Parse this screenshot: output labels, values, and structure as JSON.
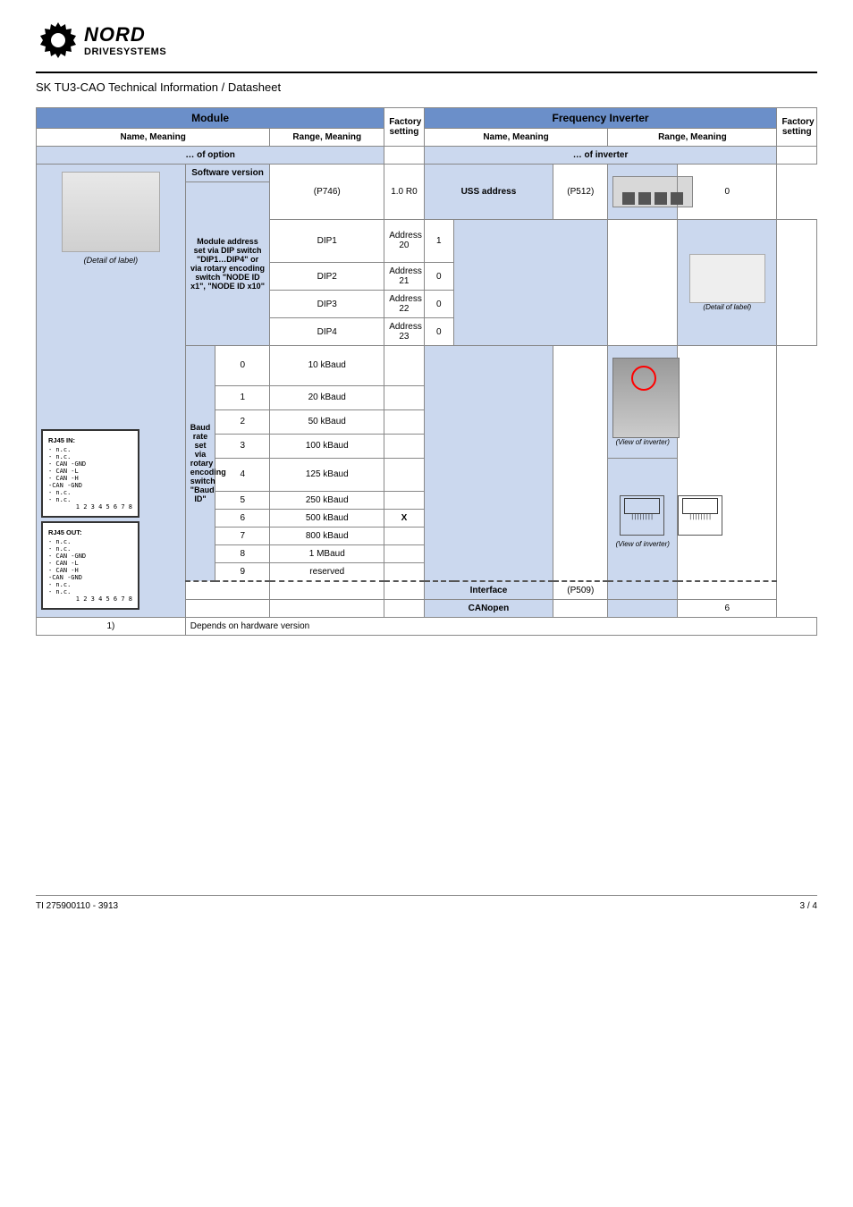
{
  "logo": {
    "brand": "NORD",
    "sub": "DRIVESYSTEMS"
  },
  "title": "SK TU3-CAO Technical Information / Datasheet",
  "headers": {
    "module": "Module",
    "inverter": "Frequency Inverter",
    "name_meaning": "Name, Meaning",
    "range_meaning": "Range, Meaning",
    "option": "… of option",
    "name_meaning2": "Name, Meaning",
    "range_meaning2": "Range, Meaning",
    "inv": "… of inverter",
    "factory": "Factory setting"
  },
  "left": {
    "labelcard": "(Detail of label)",
    "rj45in_title": "RJ45 IN:",
    "rj45out_title": "RJ45 OUT:",
    "rj45_lines": [
      "- n.c.",
      "- n.c.",
      "- CAN -GND",
      "- CAN -L",
      "- CAN -H",
      "-CAN -GND",
      "- n.c.",
      "- n.c."
    ],
    "rj45_nums_in": "1 2 3 4 5 6 7 8",
    "rj45_nums_out": "1 2 3 4 5 6 7 8"
  },
  "rows": [
    {
      "lbl": "Software version",
      "val": "(P746)",
      "rng": "",
      "lbl2": "",
      "val2": "",
      "rng2": "",
      "img": "dip",
      "imgnote": "",
      "hint": "1.0 R0"
    },
    {
      "lbl": "Module address set via DIP switch \"DIP1…DIP4\" or via rotary encoding switch \"NODE ID x1\", \"NODE ID x10\"",
      "val": "",
      "rng": "",
      "lbl2": "USS address",
      "val2": "(P512)",
      "rng2": "0",
      "img": "",
      "imgnote": "",
      "hint": ""
    },
    {
      "lbl": "",
      "val": "DIP1",
      "rng": "Address 20",
      "lbl2": "",
      "val2": "",
      "rng2": "",
      "img": "rot",
      "imgnote": "(Detail of label)",
      "hint": "1"
    },
    {
      "lbl": "",
      "val": "DIP2",
      "rng": "Address 21",
      "lbl2": "",
      "val2": "",
      "rng2": "",
      "img": "",
      "imgnote": "",
      "hint": "0"
    },
    {
      "lbl": "",
      "val": "DIP3",
      "rng": "Address 22",
      "lbl2": "",
      "val2": "",
      "rng2": "",
      "img": "",
      "imgnote": "",
      "hint": "0"
    },
    {
      "lbl": "",
      "val": "DIP4",
      "rng": "Address 23",
      "lbl2": "",
      "val2": "",
      "rng2": "",
      "img": "",
      "imgnote": "",
      "hint": "0"
    },
    {
      "lbl": "Baud rate set via rotary encoding switch \"Baud ID\"",
      "val": "0",
      "rng": "10 kBaud",
      "lbl2": "",
      "val2": "",
      "rng2": "",
      "img": "",
      "imgnote": "",
      "hint": ""
    },
    {
      "lbl": "",
      "val": "1",
      "rng": "20 kBaud",
      "lbl2": "",
      "val2": "",
      "rng2": "",
      "img": "",
      "imgnote": "",
      "hint": ""
    },
    {
      "lbl": "",
      "val": "2",
      "rng": "50 kBaud",
      "lbl2": "",
      "val2": "",
      "rng2": "",
      "img": "",
      "imgnote": "",
      "hint": ""
    },
    {
      "lbl": "",
      "val": "3",
      "rng": "100 kBaud",
      "lbl2": "",
      "val2": "",
      "rng2": "",
      "img": "inv",
      "imgnote": "(View of inverter)",
      "hint": ""
    },
    {
      "lbl": "",
      "val": "4",
      "rng": "125 kBaud",
      "lbl2": "",
      "val2": "",
      "rng2": "",
      "img": "",
      "imgnote": "",
      "hint": ""
    },
    {
      "lbl": "",
      "val": "5",
      "rng": "250 kBaud",
      "lbl2": "",
      "val2": "",
      "rng2": "",
      "img": "",
      "imgnote": "",
      "hint": ""
    },
    {
      "lbl": "",
      "val": "6",
      "rng": "500 kBaud",
      "lbl2": "",
      "val2": "",
      "rng2": "",
      "img": "",
      "imgnote": "",
      "hint": "X"
    },
    {
      "lbl": "",
      "val": "7",
      "rng": "800 kBaud",
      "lbl2": "",
      "val2": "",
      "rng2": "",
      "img": "",
      "imgnote": "",
      "hint": ""
    },
    {
      "lbl": "",
      "val": "8",
      "rng": "1 MBaud",
      "lbl2": "",
      "val2": "",
      "rng2": "",
      "img": "",
      "imgnote": "",
      "hint": ""
    },
    {
      "lbl": "",
      "val": "9",
      "rng": "reserved",
      "lbl2": "",
      "val2": "",
      "rng2": "",
      "img": "rj45",
      "imgnote": "",
      "hint": ""
    },
    {
      "lbl": "",
      "val": "",
      "rng": "",
      "lbl2": "Interface",
      "val2": "(P509)",
      "rng2": "",
      "img": "",
      "imgnote": "(View of inverter)",
      "hint": ""
    },
    {
      "lbl": "",
      "val": "",
      "rng": "",
      "lbl2": "CANopen",
      "val2": "",
      "rng2": "6",
      "img": "",
      "imgnote": "",
      "hint": ""
    }
  ],
  "footer_table": {
    "c1": "1)",
    "c2": "Depends on hardware version"
  },
  "footer": {
    "left": "TI 275900110 - 3913",
    "right": "3 / 4"
  }
}
